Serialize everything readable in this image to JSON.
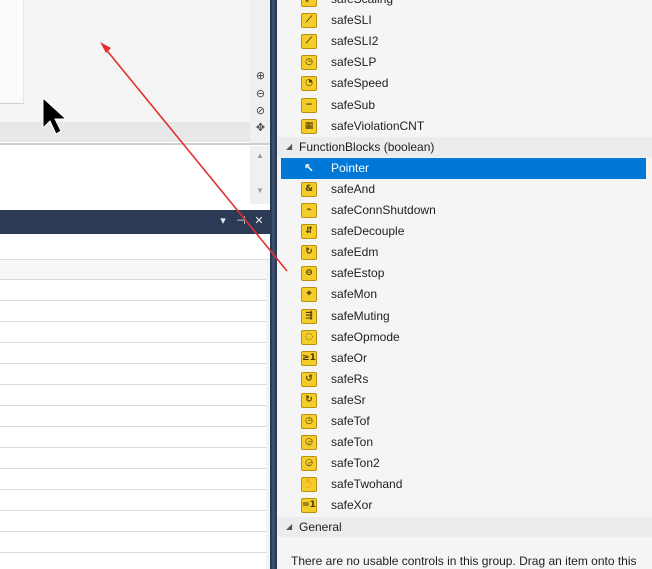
{
  "toolbox": {
    "top_items": [
      {
        "label": "safeScaling",
        "icon": "scaling-icon",
        "glyph": "⤢"
      },
      {
        "label": "safeSLI",
        "icon": "sli-icon",
        "glyph": "⟋"
      },
      {
        "label": "safeSLI2",
        "icon": "sli2-icon",
        "glyph": "⟋"
      },
      {
        "label": "safeSLP",
        "icon": "slp-icon",
        "glyph": "◷"
      },
      {
        "label": "safeSpeed",
        "icon": "speed-icon",
        "glyph": "◔"
      },
      {
        "label": "safeSub",
        "icon": "minus-icon",
        "glyph": "−"
      },
      {
        "label": "safeViolationCNT",
        "icon": "counter-icon",
        "glyph": "▦"
      }
    ],
    "group_functionblocks": "FunctionBlocks (boolean)",
    "fb_items": [
      {
        "label": "Pointer",
        "icon": "pointer-icon",
        "glyph": "↖",
        "selected": true
      },
      {
        "label": "safeAnd",
        "icon": "and-icon",
        "glyph": "&"
      },
      {
        "label": "safeConnShutdown",
        "icon": "conn-shutdown-icon",
        "glyph": "⌁"
      },
      {
        "label": "safeDecouple",
        "icon": "decouple-icon",
        "glyph": "⇵"
      },
      {
        "label": "safeEdm",
        "icon": "edm-icon",
        "glyph": "↻"
      },
      {
        "label": "safeEstop",
        "icon": "estop-icon",
        "glyph": "⊖"
      },
      {
        "label": "safeMon",
        "icon": "monitor-icon",
        "glyph": "⌖"
      },
      {
        "label": "safeMuting",
        "icon": "muting-icon",
        "glyph": "⇶"
      },
      {
        "label": "safeOpmode",
        "icon": "opmode-icon",
        "glyph": "◌"
      },
      {
        "label": "safeOr",
        "icon": "or-icon",
        "glyph": "≥1"
      },
      {
        "label": "safeRs",
        "icon": "rs-icon",
        "glyph": "↺"
      },
      {
        "label": "safeSr",
        "icon": "sr-icon",
        "glyph": "↻"
      },
      {
        "label": "safeTof",
        "icon": "tof-icon",
        "glyph": "◷"
      },
      {
        "label": "safeTon",
        "icon": "ton-icon",
        "glyph": "◶"
      },
      {
        "label": "safeTon2",
        "icon": "ton2-icon",
        "glyph": "◶"
      },
      {
        "label": "safeTwohand",
        "icon": "twohand-icon",
        "glyph": "✋"
      },
      {
        "label": "safeXor",
        "icon": "xor-icon",
        "glyph": "=1"
      }
    ],
    "group_general": "General",
    "general_empty_text": "There are no usable controls in this group. Drag an item onto this"
  },
  "dock": {
    "dropdown_icon": "▾",
    "pin_icon": "⊣",
    "close_icon": "✕"
  },
  "zoom": {
    "zoom_in": "⊕",
    "zoom_out": "⊖",
    "zoom_fit": "⊘",
    "pan": "✥"
  },
  "colors": {
    "selection": "#0078d7",
    "dock_header": "#2b3a55",
    "icon_fill": "#f4cd2a",
    "annotation_arrow": "#e03030"
  }
}
